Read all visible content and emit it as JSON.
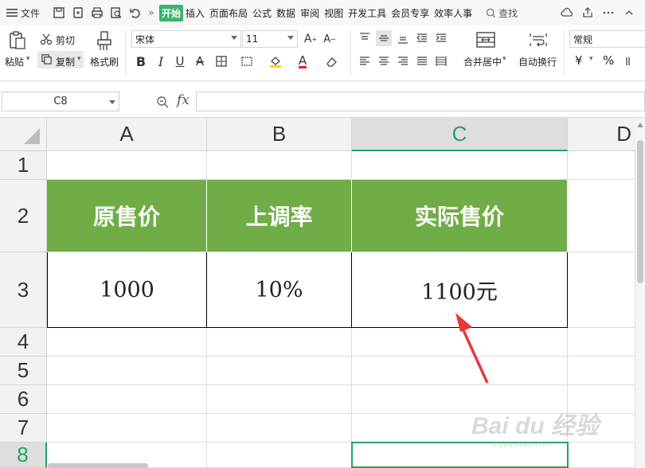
{
  "menubar": {
    "file_label": "文件",
    "tabs": [
      "开始",
      "插入",
      "页面布局",
      "公式",
      "数据",
      "审阅",
      "视图",
      "开发工具",
      "会员专享",
      "效率人事"
    ],
    "active_tab": "开始",
    "search_label": "查找"
  },
  "ribbon": {
    "paste": "粘贴",
    "cut": "剪切",
    "copy": "复制",
    "format_painter": "格式刷",
    "font_name": "宋体",
    "font_size": "11",
    "merge_center": "合并居中",
    "wrap_text": "自动换行",
    "number_format": "常规",
    "currency": "¥",
    "percent": "%"
  },
  "formula_bar": {
    "name_box": "C8",
    "fx": "fx",
    "formula": ""
  },
  "sheet": {
    "columns": [
      "A",
      "B",
      "C",
      "D"
    ],
    "rows": [
      "1",
      "2",
      "3",
      "4",
      "5",
      "6",
      "7",
      "8"
    ],
    "selected_cell": "C8",
    "header_row": [
      "原售价",
      "上调率",
      "实际售价"
    ],
    "data_row": [
      "1000",
      "10%",
      "1100元"
    ]
  },
  "colors": {
    "header_fill": "#70ad47",
    "selection": "#21a366",
    "annotation_arrow": "#e8383d"
  },
  "watermark": "Bai du 经验"
}
